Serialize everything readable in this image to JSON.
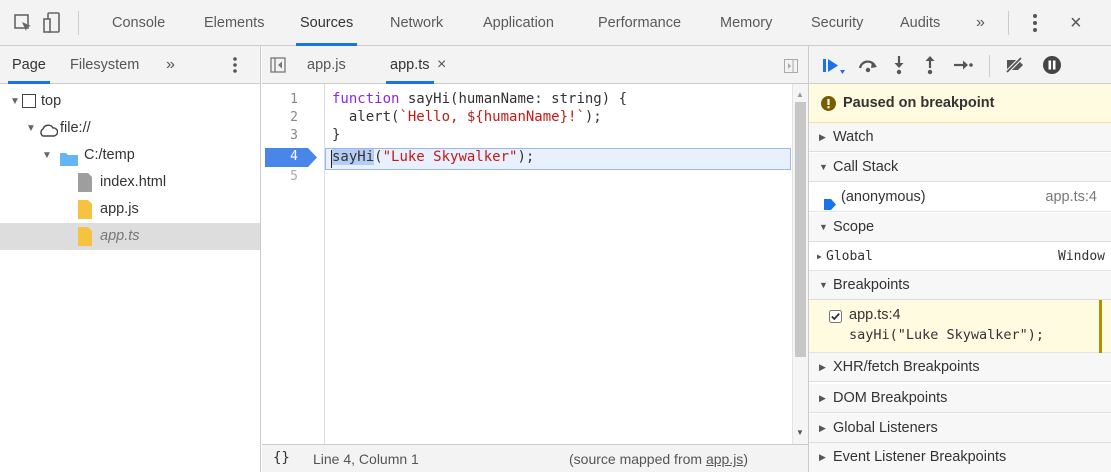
{
  "top_tabs": [
    "Console",
    "Elements",
    "Sources",
    "Network",
    "Application",
    "Performance",
    "Memory",
    "Security",
    "Audits"
  ],
  "top_more": "»",
  "top_close": "×",
  "nav_tabs": {
    "page": "Page",
    "filesystem": "Filesystem",
    "more": "»"
  },
  "file_tabs": {
    "first": "app.js",
    "second": "app.ts",
    "close": "×"
  },
  "tree": {
    "top": "top",
    "origin": "file://",
    "folder": "C:/temp",
    "files": [
      "index.html",
      "app.js",
      "app.ts"
    ]
  },
  "code": {
    "line_numbers": [
      "1",
      "2",
      "3",
      "4",
      "5"
    ],
    "line1_kw": "function",
    "line1_rest": " sayHi(humanName: string) {",
    "line2_pre": "  alert(",
    "line2_str": "`Hello, ${humanName}!`",
    "line2_post": ");",
    "line3": "}",
    "line4_fn": "sayHi",
    "line4_open": "(",
    "line4_str": "\"Luke Skywalker\"",
    "line4_close": ");"
  },
  "status": {
    "braces": "{}",
    "position": "Line 4, Column 1",
    "mapped_prefix": "(source mapped from ",
    "mapped_file": "app.js",
    "mapped_suffix": ")"
  },
  "debugger": {
    "paused": "Paused on breakpoint",
    "watch": "Watch",
    "call_stack": "Call Stack",
    "frame_name": "(anonymous)",
    "frame_loc": "app.ts:4",
    "scope": "Scope",
    "global": "Global",
    "global_value": "Window",
    "breakpoints": "Breakpoints",
    "bp_location": "app.ts:4",
    "bp_code": "sayHi(\"Luke Skywalker\");",
    "xhr": "XHR/fetch Breakpoints",
    "dom": "DOM Breakpoints",
    "listeners": "Global Listeners",
    "event_listeners": "Event Listener Breakpoints"
  },
  "colors": {
    "accent": "#1a73e8",
    "paused_bg": "#fffbe0",
    "breakpoint_blue": "#4a86e8"
  }
}
